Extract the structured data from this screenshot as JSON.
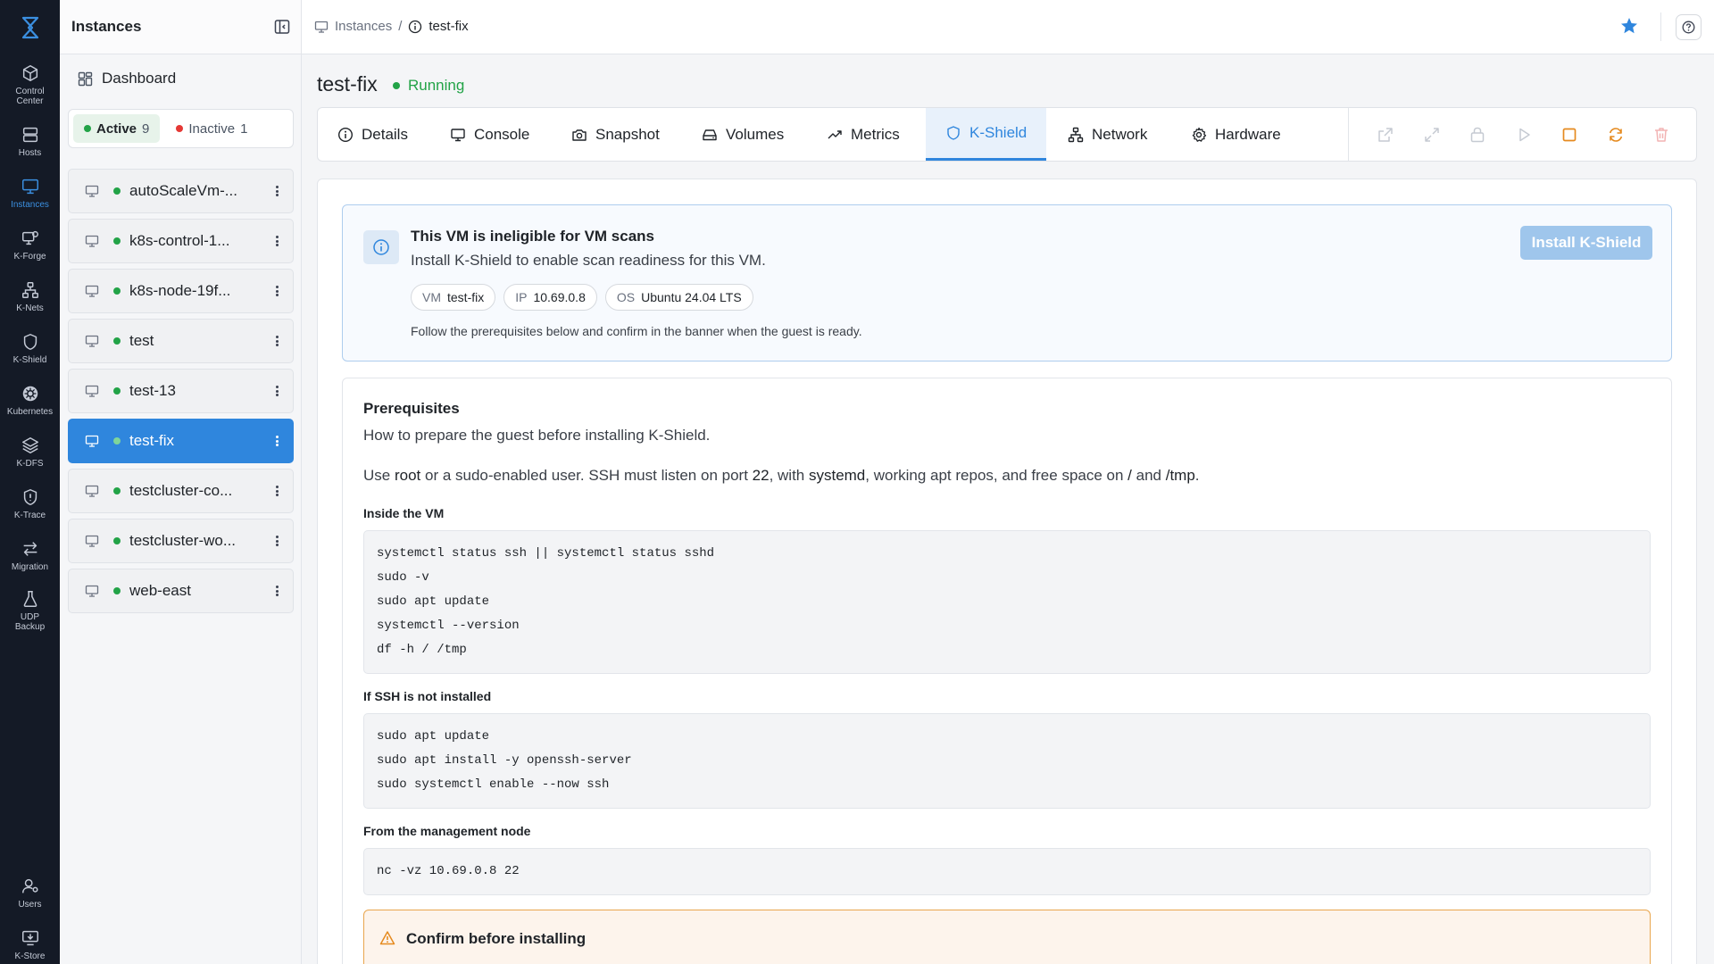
{
  "rail": {
    "items": [
      {
        "label": "Control\nCenter",
        "icon": "cube-icon"
      },
      {
        "label": "Hosts",
        "icon": "server-icon"
      },
      {
        "label": "Instances",
        "icon": "monitor-icon",
        "active": true
      },
      {
        "label": "K-Forge",
        "icon": "forge-icon"
      },
      {
        "label": "K-Nets",
        "icon": "network-icon"
      },
      {
        "label": "K-Shield",
        "icon": "shield-icon"
      },
      {
        "label": "Kubernetes",
        "icon": "helm-icon"
      },
      {
        "label": "K-DFS",
        "icon": "layers-icon"
      },
      {
        "label": "K-Trace",
        "icon": "trace-icon"
      },
      {
        "label": "Migration",
        "icon": "swap-icon"
      },
      {
        "label": "UDP\nBackup",
        "icon": "flask-icon"
      },
      {
        "label": "Users",
        "icon": "users-icon"
      },
      {
        "label": "K-Store",
        "icon": "store-icon"
      }
    ]
  },
  "sidebar": {
    "title": "Instances",
    "dashboard": "Dashboard",
    "filters": {
      "active_label": "Active",
      "active_count": "9",
      "inactive_label": "Inactive",
      "inactive_count": "1"
    },
    "instances": [
      {
        "name": "autoScaleVm-..."
      },
      {
        "name": "k8s-control-1..."
      },
      {
        "name": "k8s-node-19f..."
      },
      {
        "name": "test"
      },
      {
        "name": "test-13"
      },
      {
        "name": "test-fix",
        "selected": true
      },
      {
        "name": "testcluster-co..."
      },
      {
        "name": "testcluster-wo..."
      },
      {
        "name": "web-east"
      }
    ]
  },
  "breadcrumb": {
    "root": "Instances",
    "separator": "/",
    "current": "test-fix"
  },
  "header": {
    "title": "test-fix",
    "status": "Running",
    "status_color": "#22a347"
  },
  "tabs": [
    {
      "label": "Details",
      "icon": "info-icon"
    },
    {
      "label": "Console",
      "icon": "monitor-icon"
    },
    {
      "label": "Snapshot",
      "icon": "camera-icon"
    },
    {
      "label": "Volumes",
      "icon": "drive-icon"
    },
    {
      "label": "Metrics",
      "icon": "trend-icon"
    },
    {
      "label": "K-Shield",
      "icon": "shield-icon",
      "active": true
    },
    {
      "label": "Network",
      "icon": "network-icon"
    },
    {
      "label": "Hardware",
      "icon": "gear-icon"
    }
  ],
  "actions": [
    {
      "icon": "external-link-icon",
      "color": "#c5cad2"
    },
    {
      "icon": "expand-icon",
      "color": "#c5cad2"
    },
    {
      "icon": "lock-icon",
      "color": "#c5cad2"
    },
    {
      "icon": "play-icon",
      "color": "#c5cad2"
    },
    {
      "icon": "stop-icon",
      "color": "#e58a1f"
    },
    {
      "icon": "refresh-icon",
      "color": "#e58a1f"
    },
    {
      "icon": "trash-icon",
      "color": "#f2b3b3"
    }
  ],
  "notice": {
    "title": "This VM is ineligible for VM scans",
    "subtitle": "Install K-Shield to enable scan readiness for this VM.",
    "chips": [
      {
        "key": "VM",
        "value": "test-fix"
      },
      {
        "key": "IP",
        "value": "10.69.0.8"
      },
      {
        "key": "OS",
        "value": "Ubuntu 24.04 LTS"
      }
    ],
    "note": "Follow the prerequisites below and confirm in the banner when the guest is ready.",
    "button": "Install K-Shield"
  },
  "prereq": {
    "title": "Prerequisites",
    "subtitle": "How to prepare the guest before installing K-Shield.",
    "body": {
      "t1": "Use ",
      "root": "root",
      "t2": " or a sudo-enabled user. SSH must listen on port ",
      "port": "22",
      "t3": ", with ",
      "systemd": "systemd",
      "t4": ", working apt repos, and free space on ",
      "slash": "/",
      "t5": " and ",
      "tmp": "/tmp",
      "t6": "."
    },
    "sections": [
      {
        "label": "Inside the VM",
        "lines": [
          "systemctl status ssh || systemctl status sshd",
          "sudo -v",
          "sudo apt update",
          "systemctl --version",
          "df -h / /tmp"
        ]
      },
      {
        "label": "If SSH is not installed",
        "lines": [
          "sudo apt update",
          "sudo apt install -y openssh-server",
          "sudo systemctl enable --now ssh"
        ]
      },
      {
        "label": "From the management node",
        "lines": [
          "nc -vz 10.69.0.8 22"
        ]
      }
    ],
    "confirm_title": "Confirm before installing"
  }
}
